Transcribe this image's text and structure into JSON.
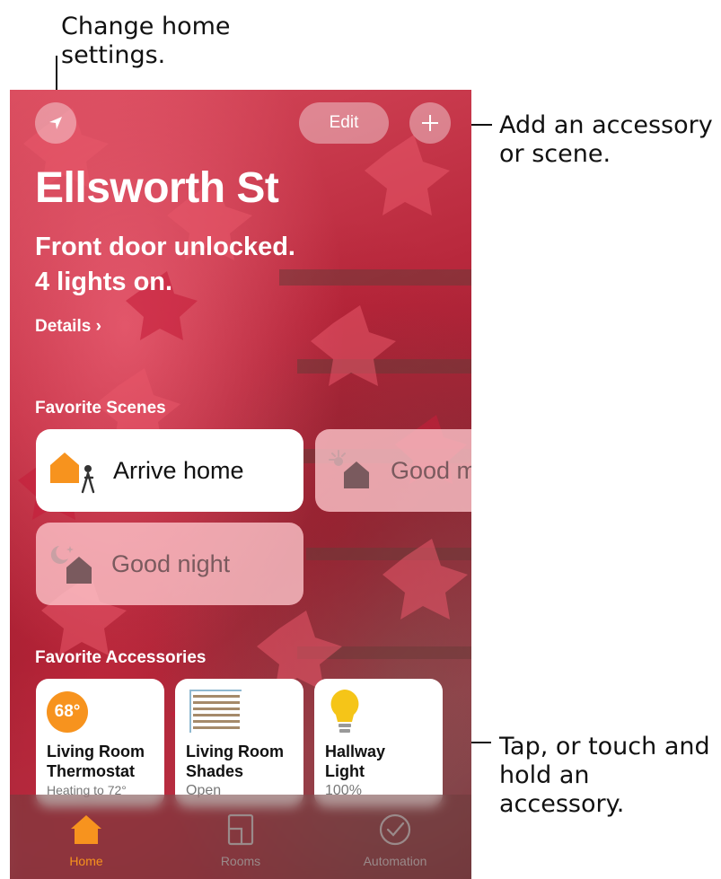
{
  "callouts": {
    "settings": "Change home settings.",
    "settings_line1": "Change home",
    "settings_line2": "settings.",
    "add_line1": "Add an accessory",
    "add_line2": "or scene.",
    "tap_line1": "Tap, or touch and",
    "tap_line2": "hold an accessory."
  },
  "header": {
    "edit_label": "Edit",
    "location_icon": "location-arrow-icon",
    "add_icon": "plus-icon"
  },
  "home": {
    "title": "Ellsworth St",
    "status_line1": "Front door unlocked.",
    "status_line2": "4 lights on.",
    "details_label": "Details ›"
  },
  "scenes": {
    "section_label": "Favorite Scenes",
    "items": [
      {
        "label": "Arrive home",
        "active": true,
        "icon": "arrive-home-icon"
      },
      {
        "label": "Good m",
        "active": false,
        "icon": "good-morning-icon"
      },
      {
        "label": "Good night",
        "active": false,
        "icon": "good-night-icon"
      }
    ]
  },
  "accessories": {
    "section_label": "Favorite Accessories",
    "items": [
      {
        "line1": "Living Room",
        "line2": "Thermostat",
        "status": "Heating to 72°",
        "badge": "68°",
        "icon": "thermostat-icon"
      },
      {
        "line1": "Living Room",
        "line2": "Shades",
        "status": "Open",
        "icon": "shades-icon"
      },
      {
        "line1": "Hallway",
        "line2": "Light",
        "status": "100%",
        "icon": "lightbulb-icon"
      }
    ]
  },
  "tabbar": {
    "items": [
      {
        "label": "Home",
        "active": true,
        "icon": "home-icon"
      },
      {
        "label": "Rooms",
        "active": false,
        "icon": "rooms-icon"
      },
      {
        "label": "Automation",
        "active": false,
        "icon": "automation-icon"
      }
    ]
  },
  "colors": {
    "accent_orange": "#f7931e",
    "bulb_yellow": "#f5c518",
    "inactive_tab": "#9a8a8a"
  }
}
